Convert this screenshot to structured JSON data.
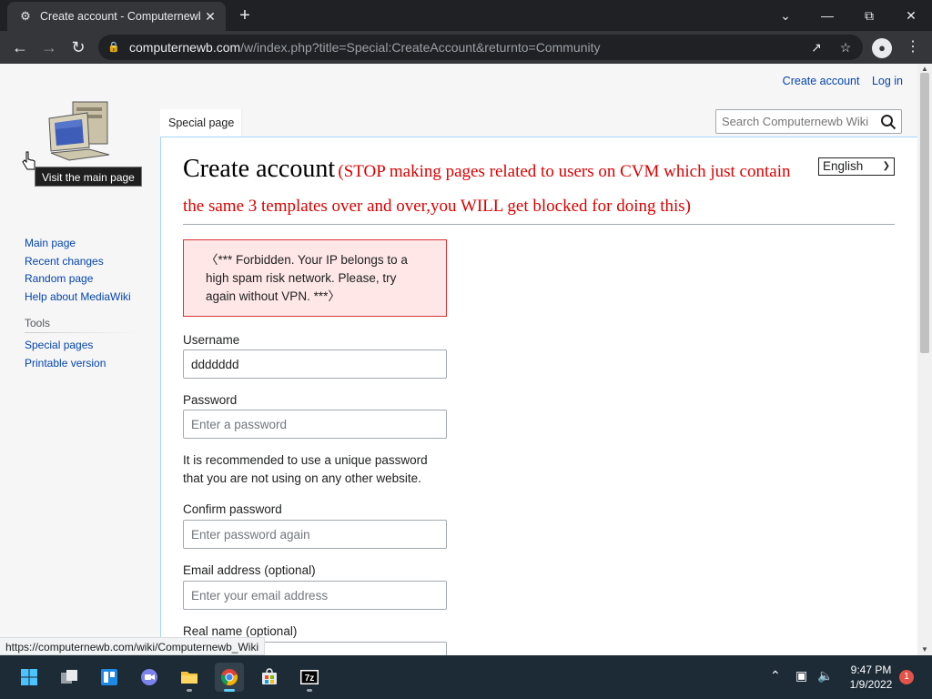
{
  "browser": {
    "tab_title": "Create account - Computernewb Wiki",
    "new_tab": "+",
    "url_host": "computernewb.com",
    "url_path": "/w/index.php?title=Special:CreateAccount&returnto=Community",
    "status_url": "https://computernewb.com/wiki/Computernewb_Wiki"
  },
  "personal": {
    "create_account": "Create account",
    "log_in": "Log in"
  },
  "logo": {
    "tooltip": "Visit the main page"
  },
  "sidebar": {
    "items": [
      "Main page",
      "Recent changes",
      "Random page",
      "Help about MediaWiki"
    ],
    "tools_heading": "Tools",
    "tools": [
      "Special pages",
      "Printable version"
    ]
  },
  "tabs": {
    "special": "Special page"
  },
  "search": {
    "placeholder": "Search Computernewb Wiki"
  },
  "content": {
    "title": "Create account",
    "title_note": "(STOP making pages related to users on CVM which just contain the same 3 templates over and over,you WILL get blocked for doing this)",
    "language": "English",
    "error": "〈*** Forbidden. Your IP belongs to a high spam risk network. Please, try again without VPN. ***〉",
    "username_label": "Username",
    "username_value": "ddddddd",
    "password_label": "Password",
    "password_placeholder": "Enter a password",
    "password_help": "It is recommended to use a unique password that you are not using on any other website.",
    "confirm_label": "Confirm password",
    "confirm_placeholder": "Enter password again",
    "email_label": "Email address (optional)",
    "email_placeholder": "Enter your email address",
    "realname_label": "Real name (optional)"
  },
  "taskbar": {
    "time": "9:47 PM",
    "date": "1/9/2022",
    "notifications": "1"
  },
  "colors": {
    "link": "#0645ad",
    "warning_red": "#dd0000",
    "error_bg": "#fee7e6",
    "chrome_dark": "#202124"
  }
}
